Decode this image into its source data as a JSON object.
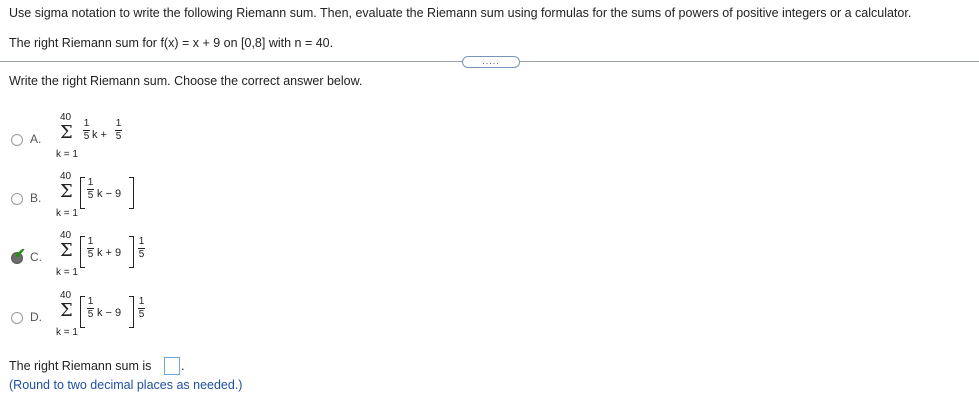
{
  "question": {
    "instruction": "Use sigma notation to write the following Riemann sum. Then, evaluate the Riemann sum using formulas for the sums of powers of positive integers or a calculator.",
    "problem": "The right Riemann sum for f(x) = x + 9 on [0,8] with n = 40.",
    "more_button": "....."
  },
  "part": {
    "prompt": "Write the right Riemann sum. Choose the correct answer below.",
    "options": [
      {
        "letter": "A.",
        "upper": "40",
        "lower": "k = 1",
        "body": "k +",
        "selected": false
      },
      {
        "letter": "B.",
        "upper": "40",
        "lower": "k = 1",
        "body": "k − 9",
        "selected": false
      },
      {
        "letter": "C.",
        "upper": "40",
        "lower": "k = 1",
        "body": "k + 9",
        "selected": true
      },
      {
        "letter": "D.",
        "upper": "40",
        "lower": "k = 1",
        "body": "k − 9",
        "selected": false
      }
    ],
    "frac_num": "1",
    "frac_den": "5",
    "answer_label": "The right Riemann sum is",
    "answer_suffix": ".",
    "answer_value": "",
    "hint": "(Round to two decimal places as needed.)"
  },
  "colors": {
    "check": "#2e8b1e",
    "hint": "#1f4fa3",
    "divider": "#9aa3ad"
  }
}
